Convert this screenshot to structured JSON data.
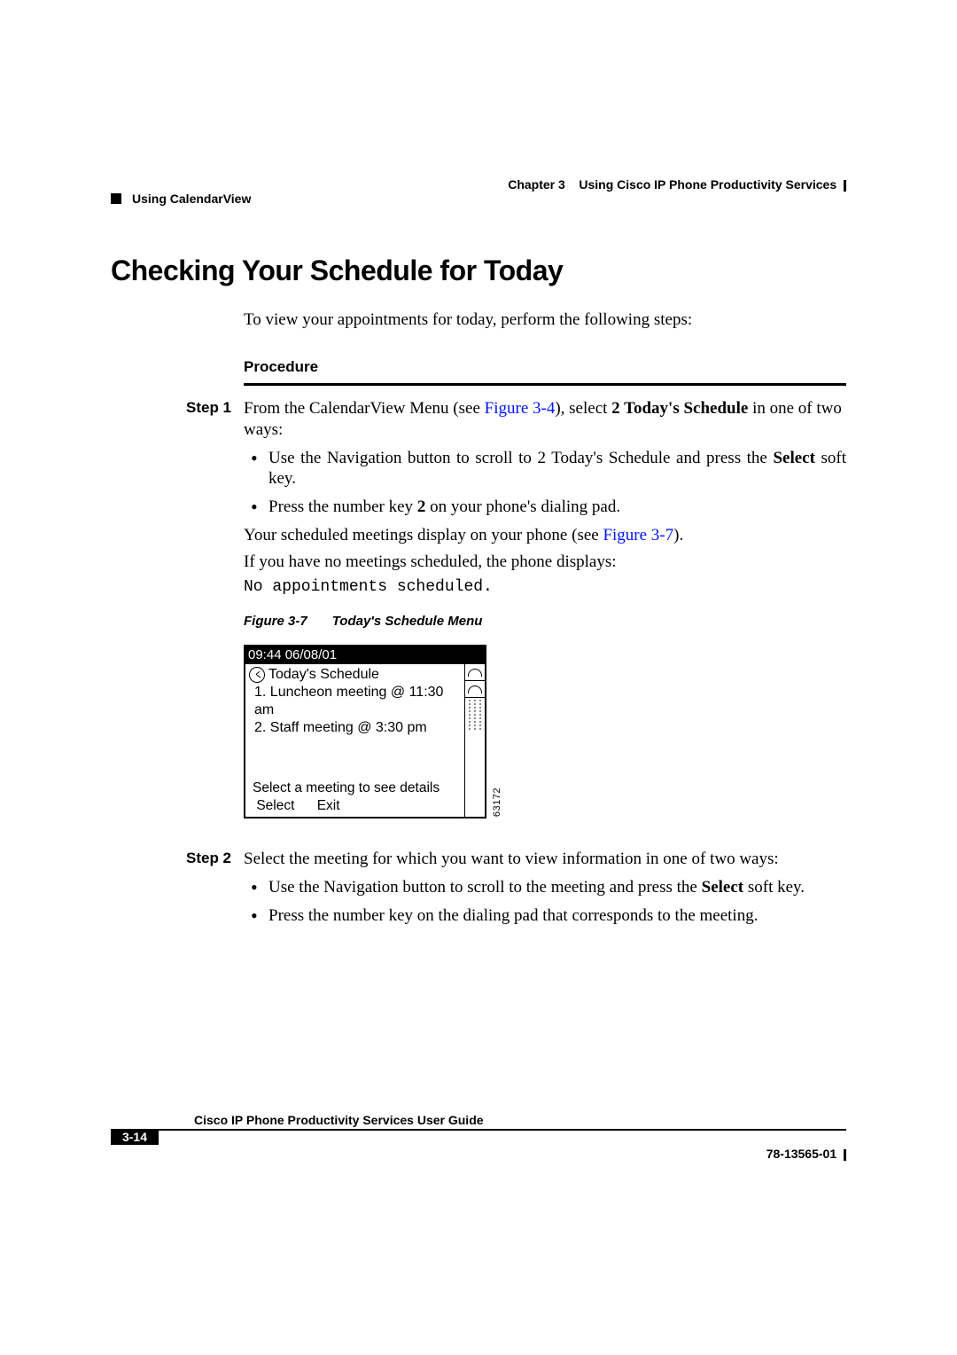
{
  "header": {
    "chapter": "Chapter 3",
    "chapterTitle": "Using Cisco IP Phone Productivity Services",
    "section": "Using CalendarView"
  },
  "heading": "Checking Your Schedule for Today",
  "intro": "To view your appointments for today, perform the following steps:",
  "procedureLabel": "Procedure",
  "step1": {
    "label": "Step 1",
    "pre": "From the CalendarView Menu (see ",
    "xref1": "Figure 3-4",
    "mid1": "), select ",
    "bold1": "2 Today's Schedule",
    "post1": " in one of two ways:",
    "b1a": "Use the Navigation button to scroll to 2 Today's Schedule and press the ",
    "b1aBold": "Select",
    "b1aPost": " soft key.",
    "b2a": "Press the number key ",
    "b2aBold": "2",
    "b2aPost": " on your phone's dialing pad.",
    "after1": "Your scheduled meetings display on your phone (see ",
    "xref2": "Figure 3-7",
    "after1b": ").",
    "after2": "If you have no meetings scheduled, the phone displays:",
    "code": "No appointments scheduled."
  },
  "figure": {
    "num": "Figure 3-7",
    "title": "Today's Schedule Menu",
    "titlebar": "09:44 06/08/01",
    "screenTitle": "Today's Schedule",
    "item1": "1. Luncheon meeting @ 11:30 am",
    "item2": "2. Staff meeting @ 3:30 pm",
    "hint": "Select a meeting to see details",
    "sk1": "Select",
    "sk2": "Exit",
    "id": "63172"
  },
  "step2": {
    "label": "Step 2",
    "text": "Select the meeting for which you want to view information in one of two ways:",
    "b1a": "Use the Navigation button to scroll to the meeting and press the ",
    "b1bold": "Select",
    "b1post": " soft key.",
    "b2": "Press the number key on the dialing pad that corresponds to the meeting."
  },
  "footer": {
    "guide": "Cisco IP Phone Productivity Services User Guide",
    "pagenum": "3-14",
    "docnum": "78-13565-01"
  }
}
